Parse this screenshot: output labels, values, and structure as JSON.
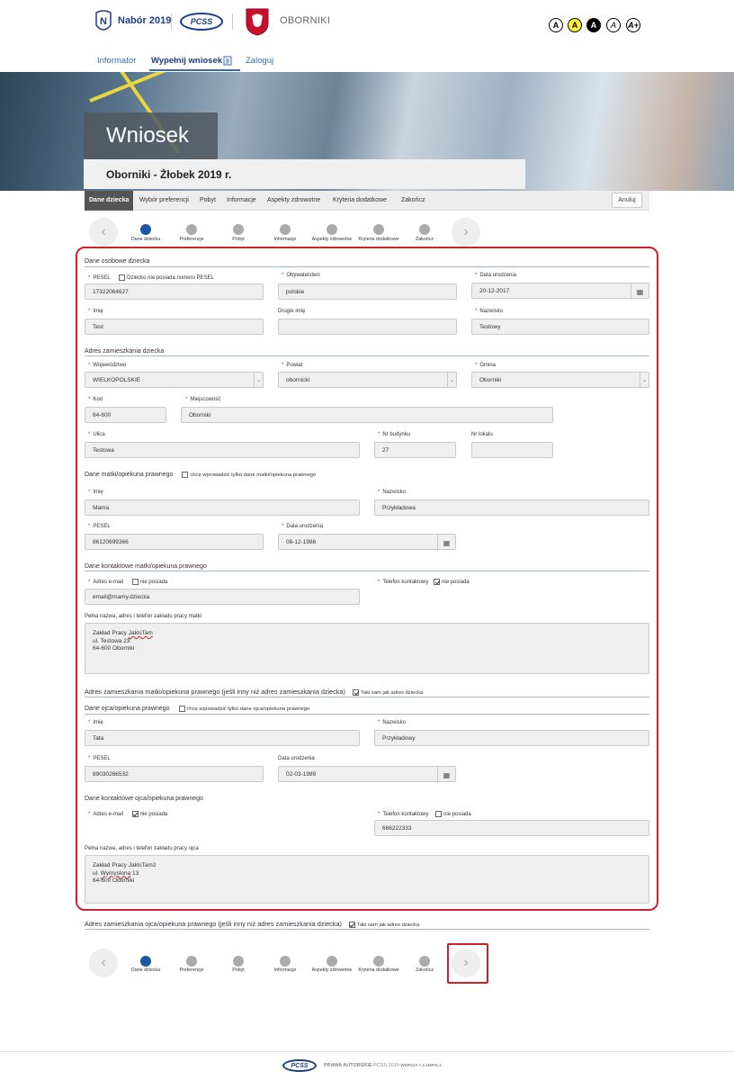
{
  "header": {
    "brand": "Nabór 2019",
    "pcss_logo": "PCSS",
    "city": "OBORNIKI",
    "accessibility": [
      "A",
      "A",
      "A",
      "A",
      "A+"
    ]
  },
  "nav": {
    "items": [
      "Informator",
      "Wypełnij wniosek",
      "Zaloguj"
    ]
  },
  "hero": {
    "title": "Wniosek",
    "subtitle": "Oborniki - Żłobek 2019 r."
  },
  "tabs": {
    "items": [
      "Dane dziecka",
      "Wybór preferencji",
      "Pobyt",
      "Informacje",
      "Aspekty zdrowotne",
      "Kryteria dodatkowe",
      "Zakończ"
    ],
    "cancel": "Anuluj"
  },
  "steps": [
    "Dane dziecka",
    "Preferencje",
    "Pobyt",
    "Informacje",
    "Aspekty zdrowotne",
    "Kryteria dodatkowe",
    "Zakończ"
  ],
  "form": {
    "child_section": "Dane osobowe dziecka",
    "pesel_label": "PESEL",
    "no_pesel_label": "Dziecko nie posiada numeru PESEL",
    "pesel": "17322064627",
    "citizenship_label": "Obywatelstwo",
    "citizenship": "polskie",
    "birth_label": "Data urodzenia",
    "birth": "20-12-2017",
    "first_name_label": "Imię",
    "first_name": "Test",
    "second_name_label": "Drugie imię",
    "second_name": "",
    "surname_label": "Nazwisko",
    "surname": "Testowy",
    "addr_section": "Adres zamieszkania dziecka",
    "voiv_label": "Województwo",
    "voiv": "WIELKOPOLSKIE",
    "county_label": "Powiat",
    "county": "obornicki",
    "gmina_label": "Gmina",
    "gmina": "Oborniki",
    "code_label": "Kod",
    "code": "64-600",
    "town_label": "Miejscowość",
    "town": "Oborniki",
    "street_label": "Ulica",
    "street": "Testowa",
    "bldg_label": "Nr budynku",
    "bldg": "27",
    "flat_label": "Nr lokalu",
    "flat": "",
    "mother_section": "Dane matki/opiekuna prawnego",
    "mother_only": "chcę wprowadzić tylko dane matki/opiekuna prawnego",
    "mother_first_label": "Imię",
    "mother_first": "Mama",
    "mother_surname_label": "Nazwisko",
    "mother_surname": "Przykładowa",
    "mother_pesel_label": "PESEL",
    "mother_pesel": "86120699366",
    "mother_birth_label": "Data urodzenia",
    "mother_birth": "06-12-1986",
    "mother_contact_section": "Dane kontaktowe matki/opiekuna prawnego",
    "email_label": "Adres e-mail",
    "no_email_label": "nie posiada",
    "mother_email": "email@mamy.dziecka",
    "phone_label": "Telefon kontaktowy",
    "no_phone_label": "nie posiada",
    "mother_work_label": "Pełna nazwa, adres i telefon zakładu pracy matki",
    "mother_work": [
      "Zakład Pracy ",
      "JakisTam",
      "ul. Testowa 23",
      "64-600 Oborniki"
    ],
    "mother_addr_section": "Adres zamieszkania matki/opiekuna prawnego (jeśli inny niż adres zamieszkania dziecka)",
    "same_addr_label": "Taki sam jak adres dziecka",
    "father_section": "Dane ojca/opiekuna prawnego",
    "father_only": "chcę wprowadzić tylko dane ojca/opiekuna prawnego",
    "father_first_label": "Imię",
    "father_first": "Tata",
    "father_surname_label": "Nazwisko",
    "father_surname": "Przykładowy",
    "father_pesel_label": "PESEL",
    "father_pesel": "89030266532",
    "father_birth_label": "Data urodzenia",
    "father_birth": "02-03-1989",
    "father_contact_section": "Dane kontaktowe ojca/opiekuna prawnego",
    "father_phone": "666222333",
    "father_work_label": "Pełna nazwa, adres i telefon zakładu pracy ojca",
    "father_work": [
      "Zakład Pracy JakisTam2",
      "ul. ",
      "Wymyslona",
      " 13",
      "64-600 Oborniki"
    ],
    "father_addr_section": "Adres zamieszkania ojca/opiekuna prawnego (jeśli inny niż adres zamieszkania dziecka)"
  },
  "footer": {
    "pcss": "PCSS",
    "copyright": "PRAWA AUTORSKIE",
    "pcss_year": "PCSS 2019",
    "version": "WERSJA 7.1.1MPIA.1"
  },
  "colors": {
    "brand": "#1a3f85",
    "link": "#2f6fb0",
    "highlight": "#d21f2b",
    "step_active": "#1a55a6"
  }
}
